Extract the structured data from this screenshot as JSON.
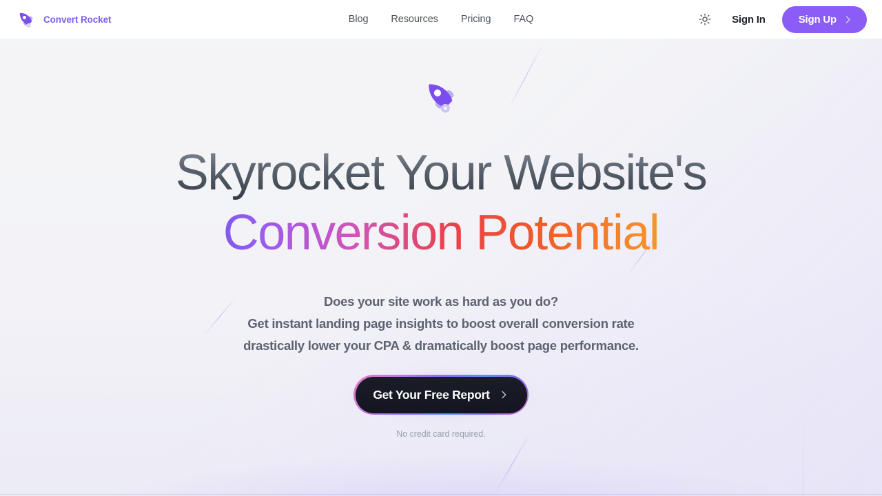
{
  "brand": {
    "name": "Convert Rocket",
    "logo_icon": "rocket-icon",
    "color": "#7c5cf0"
  },
  "nav": {
    "items": [
      {
        "label": "Blog"
      },
      {
        "label": "Resources"
      },
      {
        "label": "Pricing"
      },
      {
        "label": "FAQ"
      }
    ]
  },
  "header_right": {
    "theme_toggle_icon": "sun-icon",
    "sign_in_label": "Sign In",
    "sign_up_label": "Sign Up",
    "sign_up_icon": "chevron-right-icon",
    "sign_up_color": "#8b5cf6"
  },
  "hero": {
    "rocket_icon": "rocket-icon",
    "headline_line1": "Skyrocket Your Website's",
    "headline_line2": "Conversion Potential",
    "headline_gradient_start": "#5b57f0",
    "headline_gradient_end": "#f8ab2e",
    "subtitle_line1": "Does your site work as hard as you do?",
    "subtitle_line2": "Get instant landing page insights to boost overall conversion rate",
    "subtitle_line3": "drastically lower your CPA & dramatically boost page performance.",
    "cta_label": "Get Your Free Report",
    "cta_icon": "chevron-right-icon",
    "disclaimer": "No credit card required."
  }
}
